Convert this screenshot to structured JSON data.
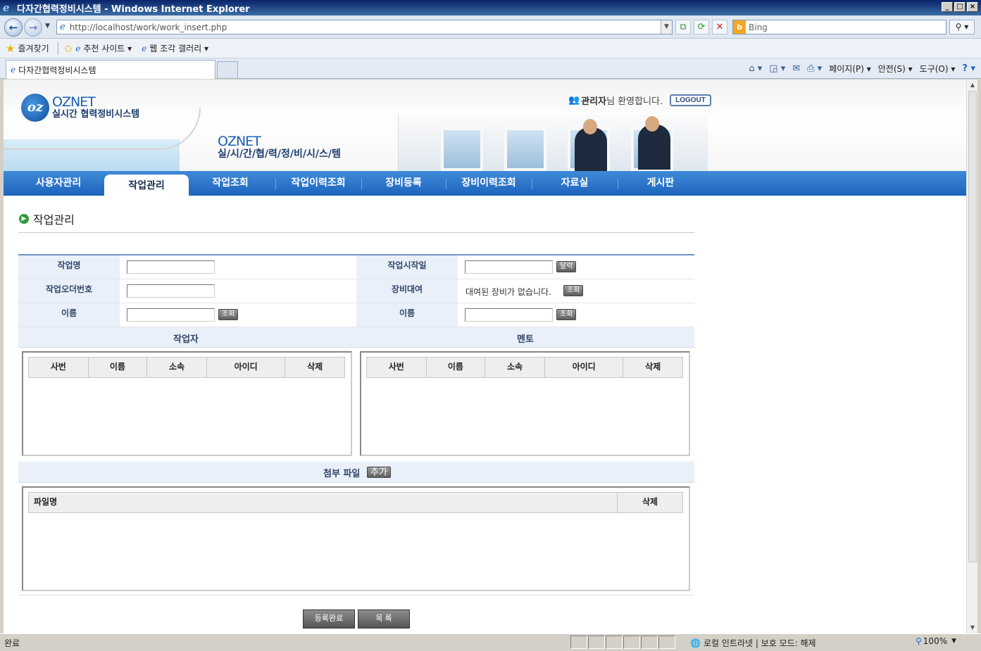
{
  "window": {
    "title": "다자간협력정비시스템 - Windows Internet Explorer"
  },
  "browser": {
    "url": "http://localhost/work/work_insert.php",
    "search_engine": "Bing",
    "favorites_label": "즐겨찾기",
    "fav_items": [
      "추천 사이트 ▾",
      "웹 조각 갤러리 ▾"
    ],
    "tab_title": "다자간협력정비시스템",
    "commands": [
      "페이지(P) ▾",
      "안전(S) ▾",
      "도구(O) ▾"
    ]
  },
  "site": {
    "logo_en": "OZNET",
    "logo_kr": "실시간 협력정비시스템",
    "slogan_en": "OZNET",
    "slogan_kr": "실/시/간/협/력/정/비/시/스/템",
    "user_name": "관리자",
    "welcome_suffix": "님 환영합니다.",
    "logout_label": "LOGOUT"
  },
  "nav": {
    "items": [
      {
        "label": "사용자관리",
        "active": false
      },
      {
        "label": "작업관리",
        "active": true
      },
      {
        "label": "작업조회",
        "active": false
      },
      {
        "label": "작업이력조회",
        "active": false
      },
      {
        "label": "장비등록",
        "active": false
      },
      {
        "label": "장비이력조회",
        "active": false
      },
      {
        "label": "자료실",
        "active": false
      },
      {
        "label": "게시판",
        "active": false
      }
    ]
  },
  "page": {
    "title": "작업관리"
  },
  "form": {
    "work_name_label": "작업명",
    "work_name_value": "",
    "start_date_label": "작업시작일",
    "start_date_value": "",
    "calendar_button": "달력",
    "order_no_label": "작업오더번호",
    "order_no_value": "",
    "equipment_label": "장비대여",
    "equipment_value": "대여된 장비가 없습니다.",
    "equipment_lookup_button": "조회",
    "worker_name_label": "이름",
    "worker_name_value": "",
    "worker_lookup_button": "조회",
    "mentor_name_label": "이름",
    "mentor_name_value": "",
    "mentor_lookup_button": "조회"
  },
  "workers": {
    "title": "작업자",
    "columns": [
      "사번",
      "이름",
      "소속",
      "아이디",
      "삭제"
    ],
    "rows": []
  },
  "mentors": {
    "title": "멘토",
    "columns": [
      "사번",
      "이름",
      "소속",
      "아이디",
      "삭제"
    ],
    "rows": []
  },
  "attachments": {
    "title": "첨부 파일",
    "add_button": "추가",
    "columns": [
      "파일명",
      "삭제"
    ],
    "rows": []
  },
  "actions": {
    "submit_label": "등록완료",
    "list_label": "목 록"
  },
  "status": {
    "text": "완료",
    "zone": "로컬 인트라넷 | 보호 모드: 해제",
    "zoom": "100%"
  }
}
